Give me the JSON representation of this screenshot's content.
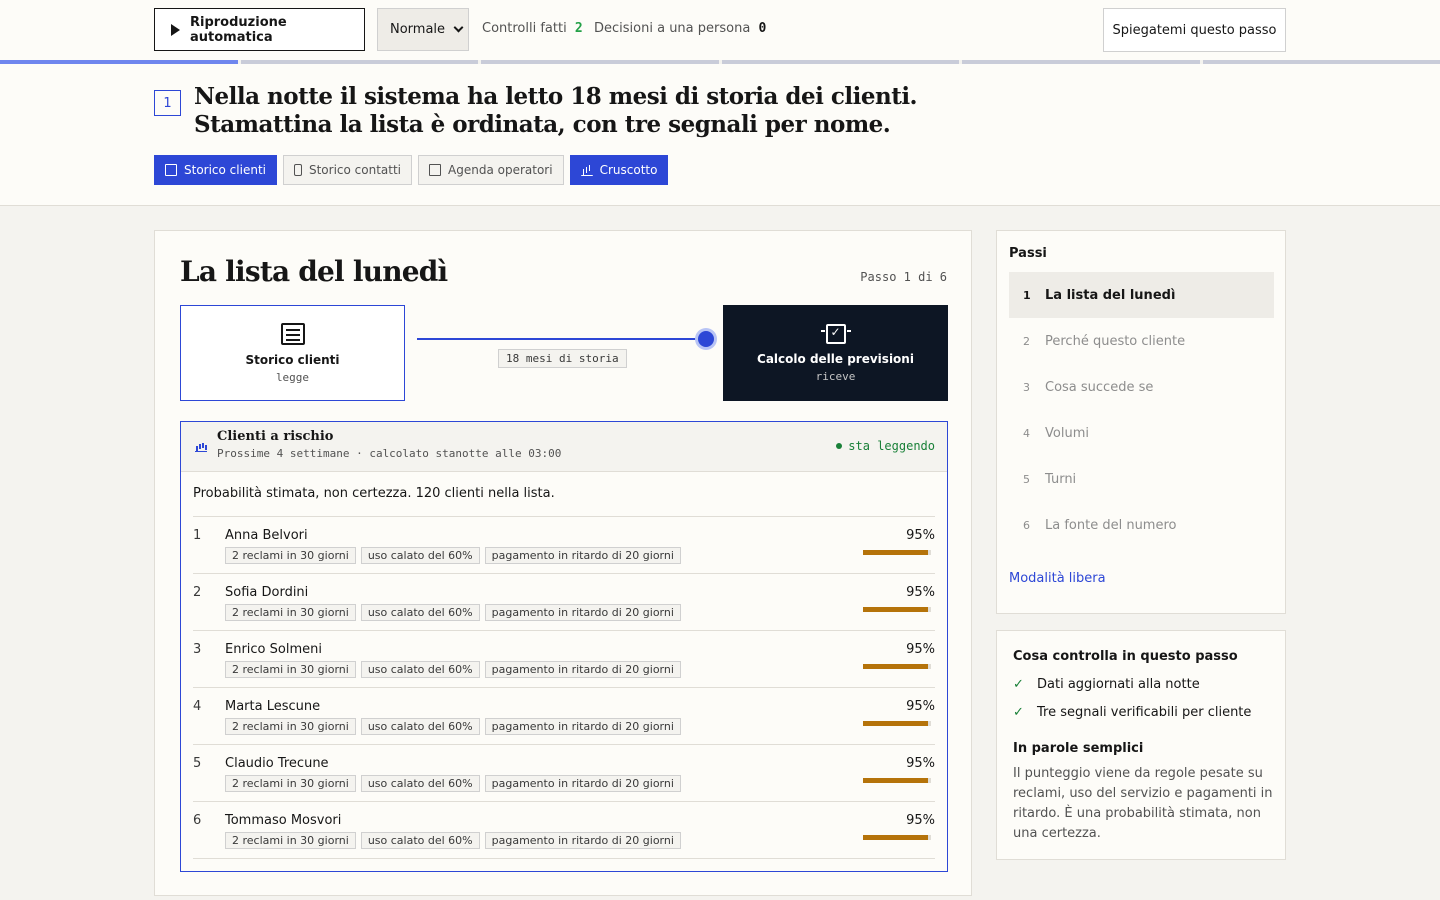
{
  "toolbar": {
    "autoplay_label": "Riproduzione automatica",
    "speed_value": "Normale",
    "checks_label": "Controlli fatti",
    "checks_value": "2",
    "decisions_label": "Decisioni a una persona",
    "decisions_value": "0",
    "explain_label": "Spiegatemi questo passo"
  },
  "progress": {
    "total_segments": 6,
    "current_segment": 1
  },
  "header": {
    "step_number": "1",
    "headline_line1": "Nella notte il sistema ha letto 18 mesi di storia dei clienti.",
    "headline_line2": "Stamattina la lista è ordinata, con tre segnali per nome.",
    "sources": [
      {
        "label": "Storico clienti",
        "icon": "table-icon",
        "active": true
      },
      {
        "label": "Storico contatti",
        "icon": "phone-icon",
        "active": false
      },
      {
        "label": "Agenda operatori",
        "icon": "calendar-icon",
        "active": false
      },
      {
        "label": "Cruscotto",
        "icon": "chart-bars-icon",
        "active": true
      }
    ]
  },
  "main": {
    "title": "La lista del lunedì",
    "step_counter": "Passo 1 di 6",
    "flow": {
      "source_title": "Storico clienti",
      "source_role": "legge",
      "link_label": "18 mesi di storia",
      "target_title": "Calcolo delle previsioni",
      "target_role": "riceve"
    },
    "panel": {
      "title": "Clienti a rischio",
      "subtitle": "Prossime 4 settimane · calcolato stanotte alle 03:00",
      "status": "sta leggendo",
      "intro": "Probabilità stimata, non certezza. 120 clienti nella lista.",
      "rows": [
        {
          "n": "1",
          "name": "Anna Belvori",
          "pct": "95%",
          "tags": [
            "2 reclami in 30 giorni",
            "uso calato del 60%",
            "pagamento in ritardo di 20 giorni"
          ]
        },
        {
          "n": "2",
          "name": "Sofia Dordini",
          "pct": "95%",
          "tags": [
            "2 reclami in 30 giorni",
            "uso calato del 60%",
            "pagamento in ritardo di 20 giorni"
          ]
        },
        {
          "n": "3",
          "name": "Enrico Solmeni",
          "pct": "95%",
          "tags": [
            "2 reclami in 30 giorni",
            "uso calato del 60%",
            "pagamento in ritardo di 20 giorni"
          ]
        },
        {
          "n": "4",
          "name": "Marta Lescune",
          "pct": "95%",
          "tags": [
            "2 reclami in 30 giorni",
            "uso calato del 60%",
            "pagamento in ritardo di 20 giorni"
          ]
        },
        {
          "n": "5",
          "name": "Claudio Trecune",
          "pct": "95%",
          "tags": [
            "2 reclami in 30 giorni",
            "uso calato del 60%",
            "pagamento in ritardo di 20 giorni"
          ]
        },
        {
          "n": "6",
          "name": "Tommaso Mosvori",
          "pct": "95%",
          "tags": [
            "2 reclami in 30 giorni",
            "uso calato del 60%",
            "pagamento in ritardo di 20 giorni"
          ]
        }
      ]
    }
  },
  "sidebar": {
    "heading": "Passi",
    "steps": [
      {
        "n": "1",
        "label": "La lista del lunedì",
        "current": true
      },
      {
        "n": "2",
        "label": "Perché questo cliente",
        "current": false
      },
      {
        "n": "3",
        "label": "Cosa succede se",
        "current": false
      },
      {
        "n": "4",
        "label": "Volumi",
        "current": false
      },
      {
        "n": "5",
        "label": "Turni",
        "current": false
      },
      {
        "n": "6",
        "label": "La fonte del numero",
        "current": false
      }
    ],
    "free_mode": "Modalità libera"
  },
  "checks": {
    "heading": "Cosa controlla in questo passo",
    "items": [
      "Dati aggiornati alla notte",
      "Tre segnali verificabili per cliente"
    ],
    "plain_heading": "In parole semplici",
    "plain_text": "Il punteggio viene da regole pesate su reclami, uso del servizio e pagamenti in ritardo. È una probabilità stimata, non una certezza."
  },
  "colors": {
    "accent": "#2d47d6",
    "dark": "#0d1624",
    "risk_bar": "#b5730a",
    "ok": "#198038"
  }
}
